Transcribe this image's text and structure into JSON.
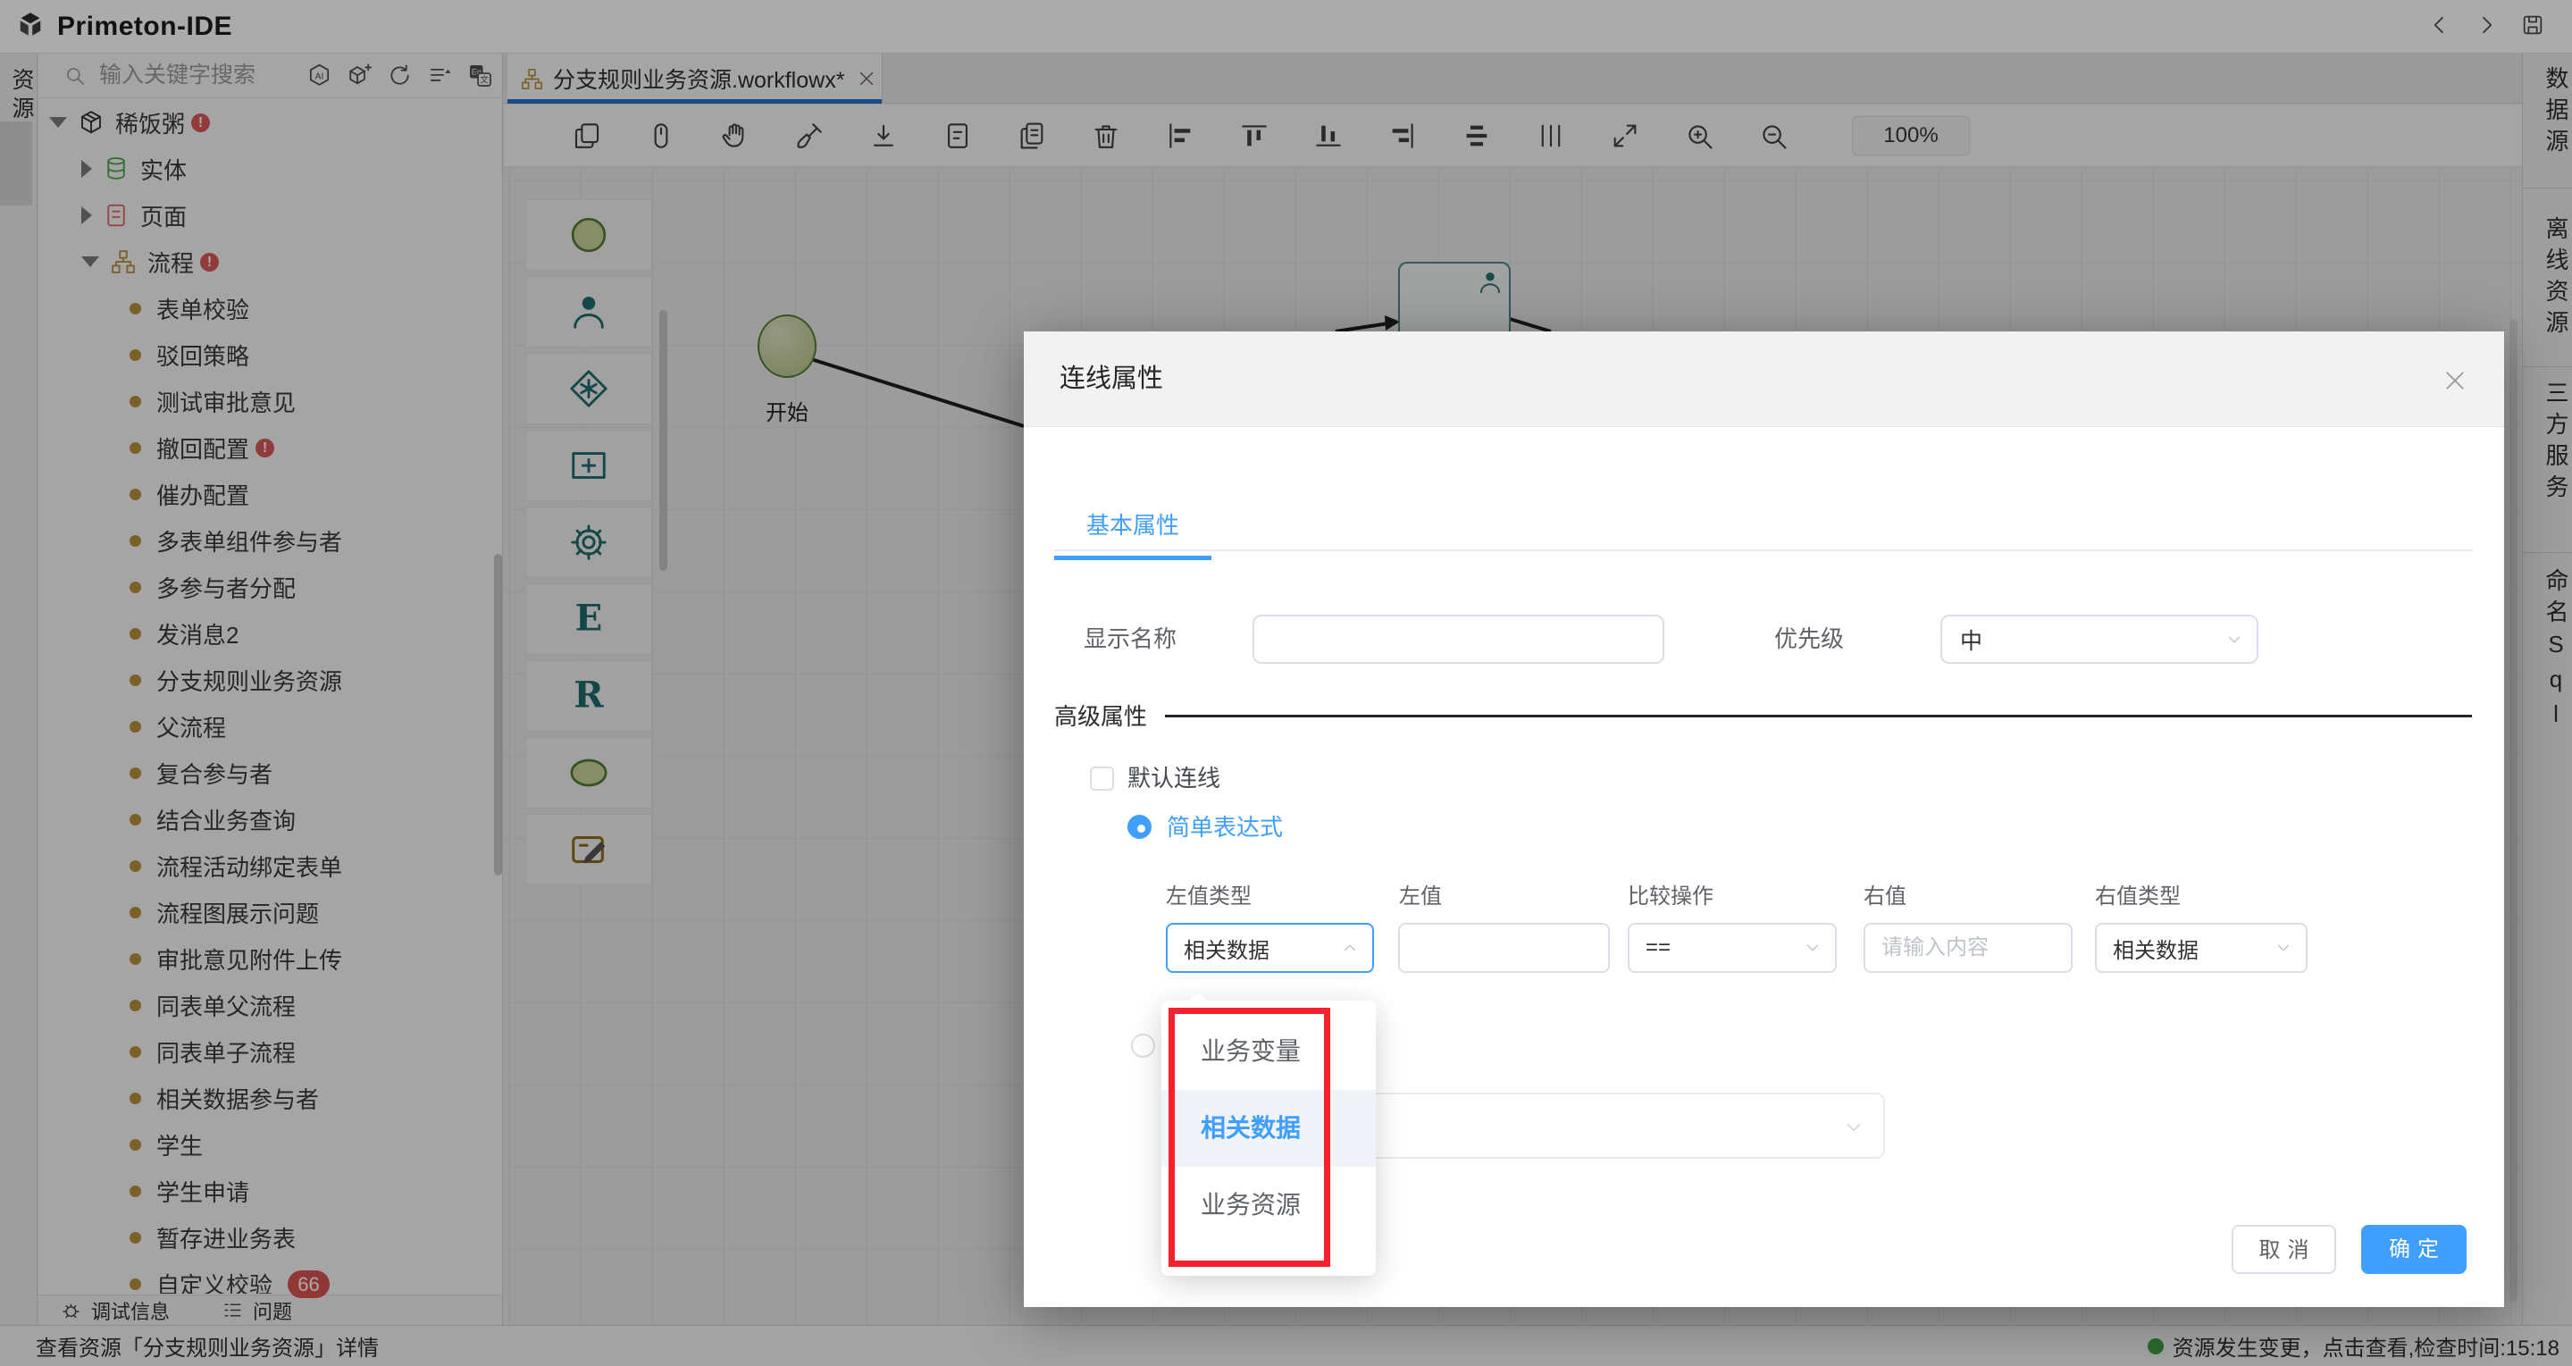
{
  "app": {
    "title": "Primeton-IDE"
  },
  "window_controls": [
    "back",
    "forward",
    "save"
  ],
  "left_activity": {
    "label": "资源"
  },
  "right_activity": {
    "tabs": [
      "数据源",
      "离线资源",
      "三方服务",
      "命名Sql"
    ]
  },
  "explorer": {
    "search_placeholder": "输入关键字搜索",
    "tools": [
      "ai",
      "cube-plus",
      "refresh",
      "sort",
      "translate"
    ],
    "tree": [
      {
        "level": 0,
        "caret": "down",
        "icon": "pkg",
        "label": "稀饭粥",
        "badge": true
      },
      {
        "level": 1,
        "caret": "right",
        "icon": "db",
        "label": "实体"
      },
      {
        "level": 1,
        "caret": "right",
        "icon": "page",
        "label": "页面"
      },
      {
        "level": 1,
        "caret": "down",
        "icon": "flow",
        "label": "流程",
        "badge": true
      },
      {
        "level": 2,
        "icon": "dot",
        "label": "表单校验"
      },
      {
        "level": 2,
        "icon": "dot",
        "label": "驳回策略"
      },
      {
        "level": 2,
        "icon": "dot",
        "label": "测试审批意见"
      },
      {
        "level": 2,
        "icon": "dot",
        "label": "撤回配置",
        "badge": true
      },
      {
        "level": 2,
        "icon": "dot",
        "label": "催办配置"
      },
      {
        "level": 2,
        "icon": "dot",
        "label": "多表单组件参与者"
      },
      {
        "level": 2,
        "icon": "dot",
        "label": "多参与者分配"
      },
      {
        "level": 2,
        "icon": "dot",
        "label": "发消息2"
      },
      {
        "level": 2,
        "icon": "dot",
        "label": "分支规则业务资源"
      },
      {
        "level": 2,
        "icon": "dot",
        "label": "父流程"
      },
      {
        "level": 2,
        "icon": "dot",
        "label": "复合参与者"
      },
      {
        "level": 2,
        "icon": "dot",
        "label": "结合业务查询"
      },
      {
        "level": 2,
        "icon": "dot",
        "label": "流程活动绑定表单"
      },
      {
        "level": 2,
        "icon": "dot",
        "label": "流程图展示问题"
      },
      {
        "level": 2,
        "icon": "dot",
        "label": "审批意见附件上传"
      },
      {
        "level": 2,
        "icon": "dot",
        "label": "同表单父流程"
      },
      {
        "level": 2,
        "icon": "dot",
        "label": "同表单子流程"
      },
      {
        "level": 2,
        "icon": "dot",
        "label": "相关数据参与者"
      },
      {
        "level": 2,
        "icon": "dot",
        "label": "学生"
      },
      {
        "level": 2,
        "icon": "dot",
        "label": "学生申请"
      },
      {
        "level": 2,
        "icon": "dot",
        "label": "暂存进业务表"
      },
      {
        "level": 2,
        "icon": "dot",
        "label": "自定义校验",
        "clipped": true
      }
    ]
  },
  "editor": {
    "tab": {
      "label": "分支规则业务资源.workflowx*"
    },
    "toolbar": [
      "copy",
      "mouse",
      "hand",
      "broom",
      "download",
      "file",
      "file-copy",
      "trash",
      "align-left",
      "align-top",
      "align-bottom",
      "align-right",
      "align-center",
      "distribute",
      "expand",
      "zoom-in",
      "zoom-out"
    ],
    "zoom": "100%"
  },
  "canvas": {
    "palette": [
      "start-circle",
      "person",
      "diamond",
      "rect-plus",
      "gear",
      "letter-e",
      "letter-r",
      "ellipse",
      "edit"
    ],
    "nodes": [
      {
        "type": "start",
        "label": "开始"
      },
      {
        "type": "task",
        "label": ""
      }
    ]
  },
  "debug_bar": {
    "items": [
      {
        "icon": "bug",
        "label": "调试信息"
      },
      {
        "icon": "list",
        "label": "问题",
        "badge": "66"
      }
    ]
  },
  "status_bar": {
    "left": "查看资源「分支规则业务资源」详情",
    "right": "资源发生变更，点击查看,检查时间:15:18"
  },
  "dialog": {
    "title": "连线属性",
    "tab": "基本属性",
    "display_name_label": "显示名称",
    "display_name_value": "",
    "priority_label": "优先级",
    "priority_value": "中",
    "advanced_label": "高级属性",
    "default_line_label": "默认连线",
    "default_line_checked": false,
    "simple_expression_label": "简单表达式",
    "columns": [
      "左值类型",
      "左值",
      "比较操作",
      "右值",
      "右值类型"
    ],
    "left_type_value": "相关数据",
    "left_value": "",
    "compare_value": "==",
    "right_value_placeholder": "请输入内容",
    "right_type_value": "相关数据",
    "dropdown_options": [
      {
        "label": "业务变量",
        "selected": false
      },
      {
        "label": "相关数据",
        "selected": true
      },
      {
        "label": "业务资源",
        "selected": false
      }
    ],
    "cancel_label": "取消",
    "ok_label": "确定",
    "accent_color": "#409eff",
    "annotation_color": "#f5222d"
  }
}
